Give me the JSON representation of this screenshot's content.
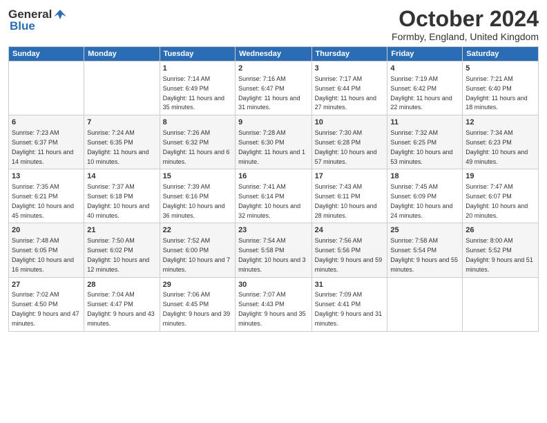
{
  "logo": {
    "general": "General",
    "blue": "Blue"
  },
  "header": {
    "title": "October 2024",
    "location": "Formby, England, United Kingdom"
  },
  "days_of_week": [
    "Sunday",
    "Monday",
    "Tuesday",
    "Wednesday",
    "Thursday",
    "Friday",
    "Saturday"
  ],
  "weeks": [
    [
      {
        "day": "",
        "sunrise": "",
        "sunset": "",
        "daylight": ""
      },
      {
        "day": "",
        "sunrise": "",
        "sunset": "",
        "daylight": ""
      },
      {
        "day": "1",
        "sunrise": "Sunrise: 7:14 AM",
        "sunset": "Sunset: 6:49 PM",
        "daylight": "Daylight: 11 hours and 35 minutes."
      },
      {
        "day": "2",
        "sunrise": "Sunrise: 7:16 AM",
        "sunset": "Sunset: 6:47 PM",
        "daylight": "Daylight: 11 hours and 31 minutes."
      },
      {
        "day": "3",
        "sunrise": "Sunrise: 7:17 AM",
        "sunset": "Sunset: 6:44 PM",
        "daylight": "Daylight: 11 hours and 27 minutes."
      },
      {
        "day": "4",
        "sunrise": "Sunrise: 7:19 AM",
        "sunset": "Sunset: 6:42 PM",
        "daylight": "Daylight: 11 hours and 22 minutes."
      },
      {
        "day": "5",
        "sunrise": "Sunrise: 7:21 AM",
        "sunset": "Sunset: 6:40 PM",
        "daylight": "Daylight: 11 hours and 18 minutes."
      }
    ],
    [
      {
        "day": "6",
        "sunrise": "Sunrise: 7:23 AM",
        "sunset": "Sunset: 6:37 PM",
        "daylight": "Daylight: 11 hours and 14 minutes."
      },
      {
        "day": "7",
        "sunrise": "Sunrise: 7:24 AM",
        "sunset": "Sunset: 6:35 PM",
        "daylight": "Daylight: 11 hours and 10 minutes."
      },
      {
        "day": "8",
        "sunrise": "Sunrise: 7:26 AM",
        "sunset": "Sunset: 6:32 PM",
        "daylight": "Daylight: 11 hours and 6 minutes."
      },
      {
        "day": "9",
        "sunrise": "Sunrise: 7:28 AM",
        "sunset": "Sunset: 6:30 PM",
        "daylight": "Daylight: 11 hours and 1 minute."
      },
      {
        "day": "10",
        "sunrise": "Sunrise: 7:30 AM",
        "sunset": "Sunset: 6:28 PM",
        "daylight": "Daylight: 10 hours and 57 minutes."
      },
      {
        "day": "11",
        "sunrise": "Sunrise: 7:32 AM",
        "sunset": "Sunset: 6:25 PM",
        "daylight": "Daylight: 10 hours and 53 minutes."
      },
      {
        "day": "12",
        "sunrise": "Sunrise: 7:34 AM",
        "sunset": "Sunset: 6:23 PM",
        "daylight": "Daylight: 10 hours and 49 minutes."
      }
    ],
    [
      {
        "day": "13",
        "sunrise": "Sunrise: 7:35 AM",
        "sunset": "Sunset: 6:21 PM",
        "daylight": "Daylight: 10 hours and 45 minutes."
      },
      {
        "day": "14",
        "sunrise": "Sunrise: 7:37 AM",
        "sunset": "Sunset: 6:18 PM",
        "daylight": "Daylight: 10 hours and 40 minutes."
      },
      {
        "day": "15",
        "sunrise": "Sunrise: 7:39 AM",
        "sunset": "Sunset: 6:16 PM",
        "daylight": "Daylight: 10 hours and 36 minutes."
      },
      {
        "day": "16",
        "sunrise": "Sunrise: 7:41 AM",
        "sunset": "Sunset: 6:14 PM",
        "daylight": "Daylight: 10 hours and 32 minutes."
      },
      {
        "day": "17",
        "sunrise": "Sunrise: 7:43 AM",
        "sunset": "Sunset: 6:11 PM",
        "daylight": "Daylight: 10 hours and 28 minutes."
      },
      {
        "day": "18",
        "sunrise": "Sunrise: 7:45 AM",
        "sunset": "Sunset: 6:09 PM",
        "daylight": "Daylight: 10 hours and 24 minutes."
      },
      {
        "day": "19",
        "sunrise": "Sunrise: 7:47 AM",
        "sunset": "Sunset: 6:07 PM",
        "daylight": "Daylight: 10 hours and 20 minutes."
      }
    ],
    [
      {
        "day": "20",
        "sunrise": "Sunrise: 7:48 AM",
        "sunset": "Sunset: 6:05 PM",
        "daylight": "Daylight: 10 hours and 16 minutes."
      },
      {
        "day": "21",
        "sunrise": "Sunrise: 7:50 AM",
        "sunset": "Sunset: 6:02 PM",
        "daylight": "Daylight: 10 hours and 12 minutes."
      },
      {
        "day": "22",
        "sunrise": "Sunrise: 7:52 AM",
        "sunset": "Sunset: 6:00 PM",
        "daylight": "Daylight: 10 hours and 7 minutes."
      },
      {
        "day": "23",
        "sunrise": "Sunrise: 7:54 AM",
        "sunset": "Sunset: 5:58 PM",
        "daylight": "Daylight: 10 hours and 3 minutes."
      },
      {
        "day": "24",
        "sunrise": "Sunrise: 7:56 AM",
        "sunset": "Sunset: 5:56 PM",
        "daylight": "Daylight: 9 hours and 59 minutes."
      },
      {
        "day": "25",
        "sunrise": "Sunrise: 7:58 AM",
        "sunset": "Sunset: 5:54 PM",
        "daylight": "Daylight: 9 hours and 55 minutes."
      },
      {
        "day": "26",
        "sunrise": "Sunrise: 8:00 AM",
        "sunset": "Sunset: 5:52 PM",
        "daylight": "Daylight: 9 hours and 51 minutes."
      }
    ],
    [
      {
        "day": "27",
        "sunrise": "Sunrise: 7:02 AM",
        "sunset": "Sunset: 4:50 PM",
        "daylight": "Daylight: 9 hours and 47 minutes."
      },
      {
        "day": "28",
        "sunrise": "Sunrise: 7:04 AM",
        "sunset": "Sunset: 4:47 PM",
        "daylight": "Daylight: 9 hours and 43 minutes."
      },
      {
        "day": "29",
        "sunrise": "Sunrise: 7:06 AM",
        "sunset": "Sunset: 4:45 PM",
        "daylight": "Daylight: 9 hours and 39 minutes."
      },
      {
        "day": "30",
        "sunrise": "Sunrise: 7:07 AM",
        "sunset": "Sunset: 4:43 PM",
        "daylight": "Daylight: 9 hours and 35 minutes."
      },
      {
        "day": "31",
        "sunrise": "Sunrise: 7:09 AM",
        "sunset": "Sunset: 4:41 PM",
        "daylight": "Daylight: 9 hours and 31 minutes."
      },
      {
        "day": "",
        "sunrise": "",
        "sunset": "",
        "daylight": ""
      },
      {
        "day": "",
        "sunrise": "",
        "sunset": "",
        "daylight": ""
      }
    ]
  ]
}
